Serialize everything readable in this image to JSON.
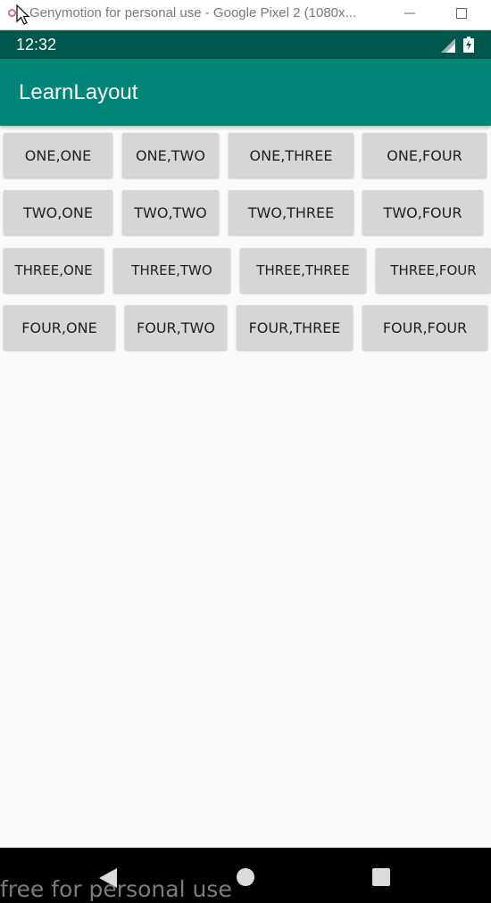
{
  "window": {
    "title": "Genymotion for personal use - Google Pixel 2 (1080x..."
  },
  "status_bar": {
    "time": "12:32",
    "icons": [
      "signal-icon",
      "battery-charging-icon"
    ]
  },
  "app_bar": {
    "title": "LearnLayout",
    "color": "#008577"
  },
  "colors": {
    "status_bar": "#00574b",
    "button_bg": "#d6d6d6",
    "background": "#fafafa"
  },
  "buttons": [
    [
      "ONE,ONE",
      "ONE,TWO",
      "ONE,THREE",
      "ONE,FOUR"
    ],
    [
      "TWO,ONE",
      "TWO,TWO",
      "TWO,THREE",
      "TWO,FOUR"
    ],
    [
      "THREE,ONE",
      "THREE,TWO",
      "THREE,THREE",
      "THREE,FOUR"
    ],
    [
      "FOUR,ONE",
      "FOUR,TWO",
      "FOUR,THREE",
      "FOUR,FOUR"
    ]
  ],
  "nav_bar": {
    "icons": [
      "back-icon",
      "home-icon",
      "recents-icon"
    ]
  },
  "watermark": "free for personal use"
}
